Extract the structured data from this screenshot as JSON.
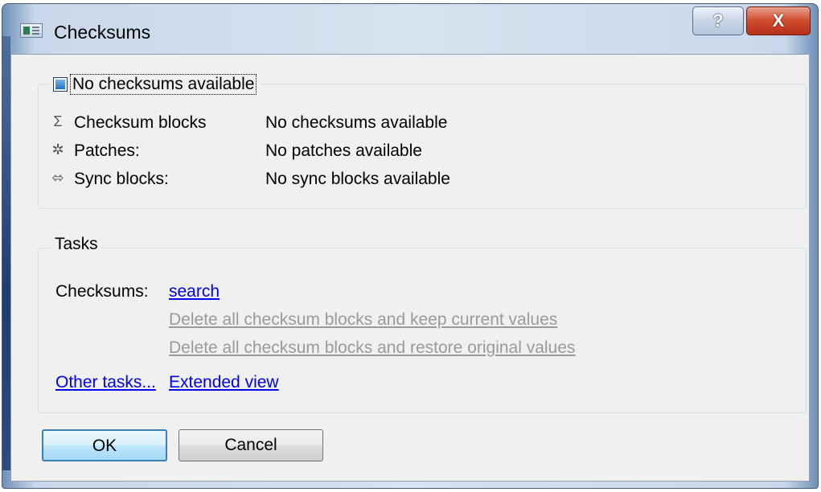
{
  "window": {
    "title": "Checksums"
  },
  "titlebar": {
    "help_label": "?",
    "close_label": "X"
  },
  "group1": {
    "checkbox_label": "No checksums available",
    "rows": [
      {
        "icon": "sigma-icon",
        "label": "Checksum blocks",
        "value": "No checksums available"
      },
      {
        "icon": "patch-icon",
        "label": "Patches:",
        "value": "No patches available"
      },
      {
        "icon": "sync-icon",
        "label": "Sync blocks:",
        "value": "No sync blocks available"
      }
    ]
  },
  "tasks": {
    "title": "Tasks",
    "checksums_label": "Checksums:",
    "search_link": "search",
    "delete_keep": "Delete all checksum blocks and keep current values",
    "delete_restore": "Delete all checksum blocks and restore original values",
    "other_tasks": "Other tasks...",
    "extended_view": "Extended view"
  },
  "buttons": {
    "ok": "OK",
    "cancel": "Cancel"
  }
}
